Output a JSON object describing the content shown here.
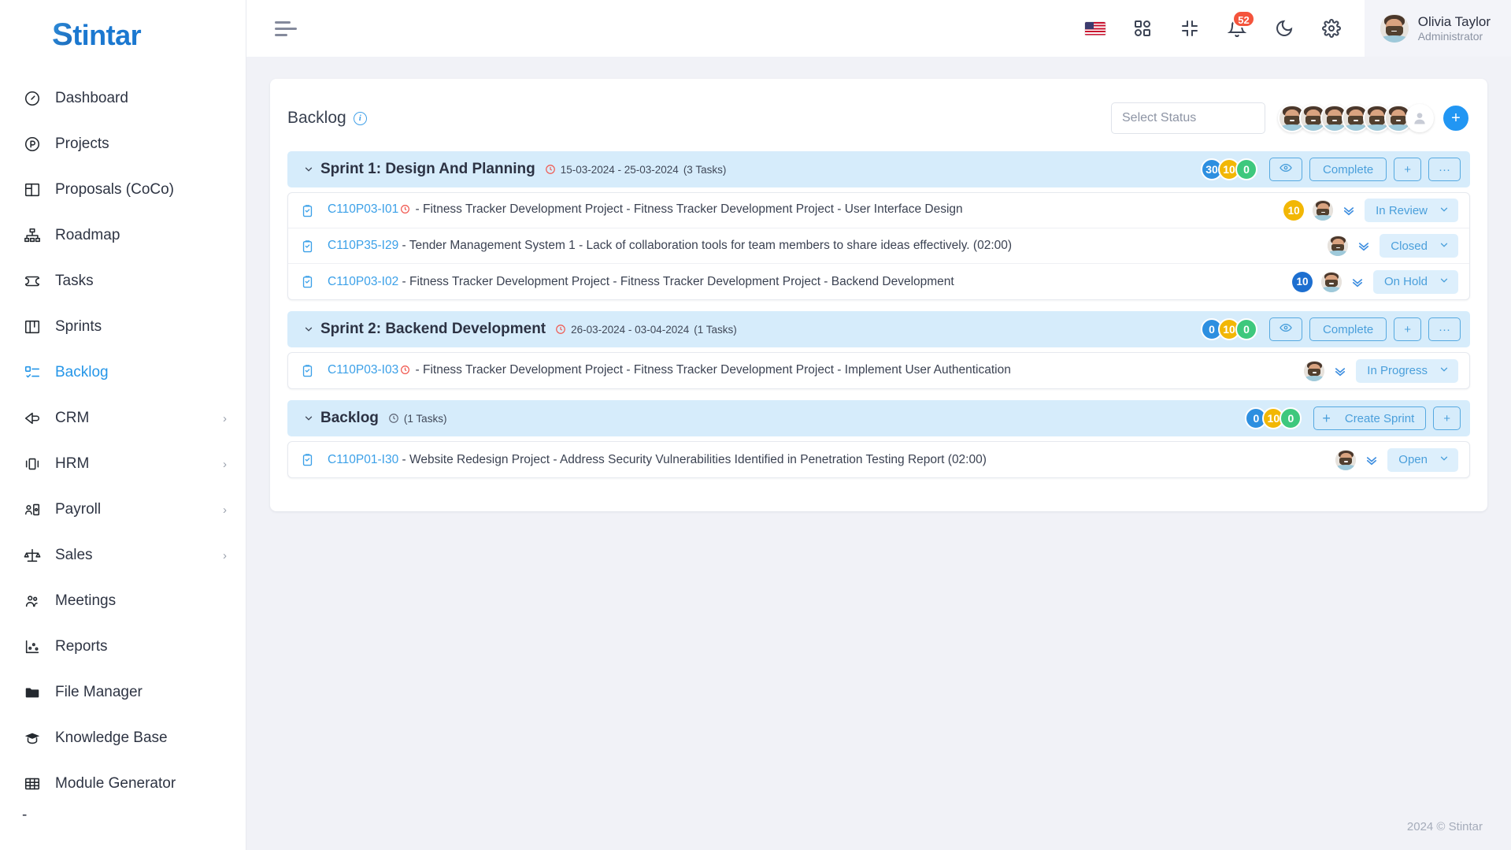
{
  "brand": {
    "name": "Stintar",
    "logo_mark": "S"
  },
  "sidebar": {
    "items": [
      {
        "label": "Dashboard",
        "icon": "gauge-icon",
        "active": false,
        "expandable": false
      },
      {
        "label": "Projects",
        "icon": "circle-p-icon",
        "active": false,
        "expandable": false
      },
      {
        "label": "Proposals (CoCo)",
        "icon": "layout-icon",
        "active": false,
        "expandable": false
      },
      {
        "label": "Roadmap",
        "icon": "hierarchy-icon",
        "active": false,
        "expandable": false
      },
      {
        "label": "Tasks",
        "icon": "ticket-icon",
        "active": false,
        "expandable": false
      },
      {
        "label": "Sprints",
        "icon": "board-icon",
        "active": false,
        "expandable": false
      },
      {
        "label": "Backlog",
        "icon": "checklist-icon",
        "active": true,
        "expandable": false
      },
      {
        "label": "CRM",
        "icon": "megaphone-icon",
        "active": false,
        "expandable": true
      },
      {
        "label": "HRM",
        "icon": "badge-icon",
        "active": false,
        "expandable": true
      },
      {
        "label": "Payroll",
        "icon": "person-card-icon",
        "active": false,
        "expandable": true
      },
      {
        "label": "Sales",
        "icon": "scales-icon",
        "active": false,
        "expandable": true
      },
      {
        "label": "Meetings",
        "icon": "people-icon",
        "active": false,
        "expandable": false
      },
      {
        "label": "Reports",
        "icon": "chart-dots-icon",
        "active": false,
        "expandable": false
      },
      {
        "label": "File Manager",
        "icon": "folder-icon",
        "active": false,
        "expandable": false
      },
      {
        "label": "Knowledge Base",
        "icon": "graduation-cap-icon",
        "active": false,
        "expandable": false
      },
      {
        "label": "Module Generator",
        "icon": "grid-table-icon",
        "active": false,
        "expandable": false
      }
    ],
    "tail_label": "-"
  },
  "topbar": {
    "menu_toggle": "hamburger-icon",
    "icons": [
      {
        "name": "language-flag-icon",
        "label": "US"
      },
      {
        "name": "apps-grid-icon",
        "label": "Apps"
      },
      {
        "name": "fullscreen-collapse-icon",
        "label": "Collapse"
      },
      {
        "name": "notification-bell-icon",
        "label": "Notifications",
        "badge": "52"
      },
      {
        "name": "dark-mode-moon-icon",
        "label": "Dark mode"
      },
      {
        "name": "settings-gear-icon",
        "label": "Settings"
      }
    ],
    "user": {
      "name": "Olivia Taylor",
      "role": "Administrator"
    }
  },
  "page": {
    "title": "Backlog",
    "info_glyph": "i",
    "status_filter": {
      "placeholder": "Select Status",
      "value": ""
    },
    "member_avatars": 6,
    "add_member_label": "+"
  },
  "groups": [
    {
      "name": "Sprint 1: Design And Planning",
      "has_date": true,
      "date_range": "15-03-2024 - 25-03-2024",
      "task_count_label": "(3 Tasks)",
      "counts": {
        "blue": "30",
        "amber": "10",
        "green": "0"
      },
      "actions": {
        "view": "eye-icon",
        "complete": "Complete",
        "add": "+",
        "more": "···"
      },
      "is_backlog": false,
      "tasks": [
        {
          "code": "C110P03-I01",
          "urgent": true,
          "title": " - Fitness Tracker Development Project - Fitness Tracker Development Project - User Interface Design",
          "count": "10",
          "count_color": "amber",
          "status": "In Review"
        },
        {
          "code": "C110P35-I29",
          "urgent": false,
          "title": " - Tender Management System 1 - Lack of collaboration tools for team members to share ideas effectively. (02:00)",
          "count": "",
          "count_color": "",
          "status": "Closed"
        },
        {
          "code": "C110P03-I02",
          "urgent": false,
          "title": " - Fitness Tracker Development Project - Fitness Tracker Development Project - Backend Development",
          "count": "10",
          "count_color": "blue",
          "status": "On Hold"
        }
      ]
    },
    {
      "name": "Sprint 2: Backend Development",
      "has_date": true,
      "date_range": "26-03-2024 - 03-04-2024",
      "task_count_label": "(1 Tasks)",
      "counts": {
        "blue": "0",
        "amber": "10",
        "green": "0"
      },
      "actions": {
        "view": "eye-icon",
        "complete": "Complete",
        "add": "+",
        "more": "···"
      },
      "is_backlog": false,
      "tasks": [
        {
          "code": "C110P03-I03",
          "urgent": true,
          "title": " - Fitness Tracker Development Project - Fitness Tracker Development Project - Implement User Authentication",
          "count": "",
          "count_color": "",
          "status": "In Progress"
        }
      ]
    },
    {
      "name": "Backlog",
      "has_date": false,
      "date_range": "",
      "task_count_label": "(1 Tasks)",
      "counts": {
        "blue": "0",
        "amber": "10",
        "green": "0"
      },
      "actions": {
        "create_sprint": "Create Sprint",
        "add": "+"
      },
      "is_backlog": true,
      "tasks": [
        {
          "code": "C110P01-I30",
          "urgent": false,
          "title": " - Website Redesign Project - Address Security Vulnerabilities Identified in Penetration Testing Report (02:00)",
          "count": "",
          "count_color": "",
          "status": "Open"
        }
      ]
    }
  ],
  "footer": {
    "copyright": "2024 © Stintar"
  },
  "colors": {
    "accent_blue": "#2596e8",
    "group_header_bg": "#d6ecfb",
    "badge_blue": "#2d8fe0",
    "badge_amber": "#f2b705",
    "badge_green": "#3ec87d",
    "notification_red": "#f4543c"
  }
}
